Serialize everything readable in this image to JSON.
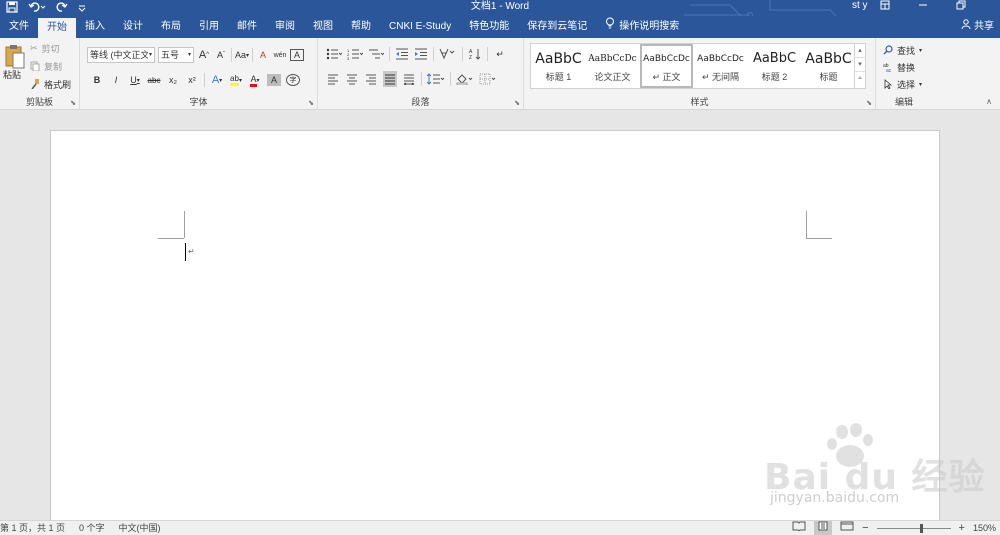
{
  "titlebar": {
    "title": "文档1 - Word",
    "user": "st y",
    "qat": [
      "save-icon",
      "undo-icon",
      "redo-icon",
      "customize-icon"
    ]
  },
  "tabs": [
    {
      "label": "文件",
      "active": false
    },
    {
      "label": "开始",
      "active": true
    },
    {
      "label": "插入",
      "active": false
    },
    {
      "label": "设计",
      "active": false
    },
    {
      "label": "布局",
      "active": false
    },
    {
      "label": "引用",
      "active": false
    },
    {
      "label": "邮件",
      "active": false
    },
    {
      "label": "审阅",
      "active": false
    },
    {
      "label": "视图",
      "active": false
    },
    {
      "label": "帮助",
      "active": false
    },
    {
      "label": "CNKI E-Study",
      "active": false
    },
    {
      "label": "特色功能",
      "active": false
    },
    {
      "label": "保存到云笔记",
      "active": false
    }
  ],
  "tell_me": "操作说明搜索",
  "share": "共享",
  "clipboard": {
    "paste": "粘贴",
    "cut": "剪切",
    "copy": "复制",
    "format_painter": "格式刷",
    "label": "剪贴板"
  },
  "font": {
    "font_name": "等线 (中文正文",
    "font_size": "五号",
    "grow": "A",
    "shrink": "A",
    "change_case": "Aa",
    "clear_format": "A",
    "phonetic": "wén",
    "char_border": "A",
    "bold": "B",
    "italic": "I",
    "underline": "U",
    "strike": "abc",
    "subscript": "x₂",
    "superscript": "x²",
    "text_effect": "A",
    "highlight": "ab",
    "font_color": "A",
    "char_shading": "A",
    "enclose": "字",
    "label": "字体"
  },
  "paragraph": {
    "label": "段落"
  },
  "styles": {
    "label": "样式",
    "items": [
      {
        "preview": "AaBbC",
        "name": "标题 1",
        "selected": false
      },
      {
        "preview": "AaBbCcDc",
        "name": "论文正文",
        "selected": false
      },
      {
        "preview": "AaBbCcDc",
        "name": "↵ 正文",
        "selected": true
      },
      {
        "preview": "AaBbCcDc",
        "name": "↵ 无间隔",
        "selected": false
      },
      {
        "preview": "AaBbC",
        "name": "标题 2",
        "selected": false
      },
      {
        "preview": "AaBbC",
        "name": "标题",
        "selected": false
      }
    ]
  },
  "editing": {
    "find": "查找",
    "replace": "替换",
    "select": "选择",
    "label": "编辑"
  },
  "document": {
    "paragraph_mark": "↵"
  },
  "statusbar": {
    "page": "第 1 页，共 1 页",
    "words": "0 个字",
    "language": "中文(中国)",
    "zoom": "150%",
    "zoom_fraction": 0.6
  },
  "watermark": {
    "logo": "Bai du 经验",
    "url": "jingyan.baidu.com"
  },
  "colors": {
    "brand": "#2b579a",
    "ribbon": "#f3f3f3",
    "highlight": "#ffff00",
    "font_color": "#ff0000"
  }
}
